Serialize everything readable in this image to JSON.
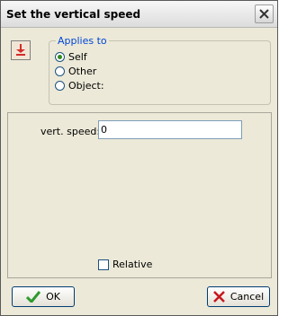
{
  "window": {
    "title": "Set the vertical speed"
  },
  "applies_to": {
    "legend": "Applies to",
    "options": [
      {
        "label": "Self",
        "checked": true
      },
      {
        "label": "Other",
        "checked": false
      },
      {
        "label": "Object:",
        "checked": false
      }
    ]
  },
  "fields": {
    "vert_speed": {
      "label": "vert. speed:",
      "value": "0"
    }
  },
  "relative": {
    "label": "Relative",
    "checked": false
  },
  "buttons": {
    "ok": "OK",
    "cancel": "Cancel"
  },
  "colors": {
    "legend": "#0046d5",
    "ok_check": "#2d9a2d",
    "cancel_x": "#c8161d",
    "action_icon": "#d42a2a"
  },
  "icons": {
    "action": "vertical-speed-arrow-icon",
    "ok": "checkmark-icon",
    "cancel": "cross-icon",
    "close": "close-icon"
  }
}
